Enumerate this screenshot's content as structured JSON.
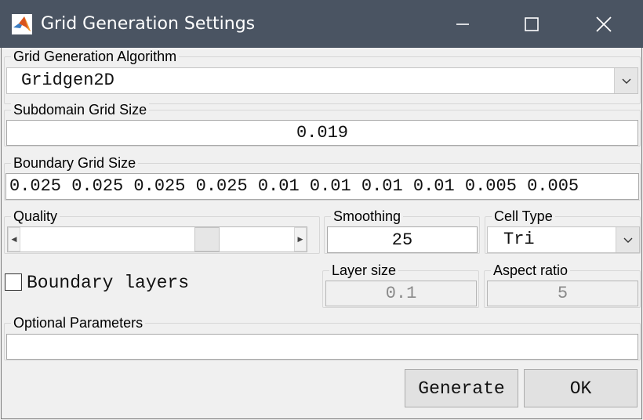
{
  "window": {
    "title": "Grid Generation Settings",
    "app_icon": "matlab-icon",
    "controls": {
      "minimize_icon": "minimize-icon",
      "maximize_icon": "maximize-icon",
      "close_icon": "close-icon"
    }
  },
  "algorithm": {
    "group_label": "Grid Generation Algorithm",
    "selected": "Gridgen2D"
  },
  "subdomain": {
    "group_label": "Subdomain Grid Size",
    "value": "0.019"
  },
  "boundary": {
    "group_label": "Boundary Grid Size",
    "value": "0.025 0.025 0.025 0.025 0.01 0.01 0.01 0.01 0.005 0.005"
  },
  "quality": {
    "group_label": "Quality",
    "level": 0.7
  },
  "smoothing": {
    "group_label": "Smoothing",
    "value": "25"
  },
  "cell_type": {
    "group_label": "Cell Type",
    "selected": "Tri"
  },
  "boundary_layers": {
    "label": "Boundary layers",
    "checked": false
  },
  "layer_size": {
    "group_label": "Layer size",
    "value": "0.1"
  },
  "aspect_ratio": {
    "group_label": "Aspect ratio",
    "value": "5"
  },
  "optional": {
    "group_label": "Optional Parameters",
    "value": ""
  },
  "buttons": {
    "generate": "Generate",
    "ok": "OK"
  }
}
